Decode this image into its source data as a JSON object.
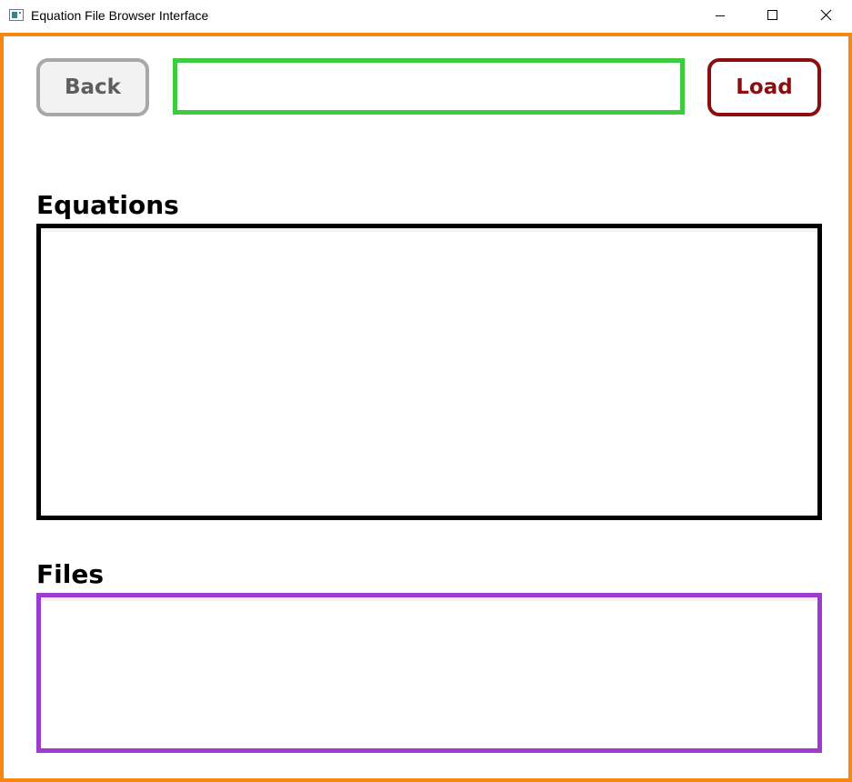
{
  "window": {
    "title": "Equation File Browser Interface"
  },
  "toolbar": {
    "back_label": "Back",
    "path_value": "",
    "path_placeholder": "",
    "load_label": "Load"
  },
  "equations": {
    "heading": "Equations",
    "items": []
  },
  "files": {
    "heading": "Files",
    "items": []
  },
  "colors": {
    "frame": "#f5890f",
    "path_border": "#3ecb3e",
    "load_accent": "#8b0d0d",
    "back_border": "#a8a8a8",
    "equations_border": "#000000",
    "files_border": "#9b3bcf"
  },
  "icons": {
    "app": "app-window-icon",
    "minimize": "minimize-icon",
    "maximize": "maximize-icon",
    "close": "close-icon"
  }
}
